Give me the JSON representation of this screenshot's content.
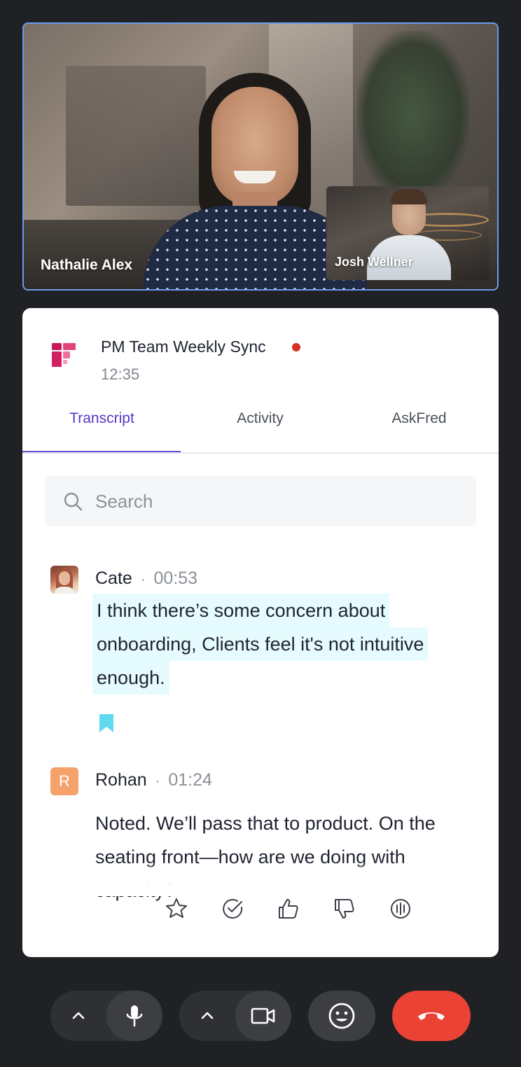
{
  "video": {
    "main_name": "Nathalie Alex",
    "pip_name": "Josh Wellner"
  },
  "meeting": {
    "title": "PM Team Weekly Sync",
    "time": "12:35",
    "live_color": "#d93025"
  },
  "tabs": [
    {
      "label": "Transcript",
      "active": true
    },
    {
      "label": "Activity",
      "active": false
    },
    {
      "label": "AskFred",
      "active": false
    }
  ],
  "search": {
    "placeholder": "Search",
    "value": ""
  },
  "transcript": [
    {
      "speaker": "Cate",
      "sep": "·",
      "timestamp": "00:53",
      "lines": [
        "I think there’s some concern about",
        "onboarding, Clients feel it's not intuitive",
        "enough."
      ],
      "highlighted": true,
      "bookmarked": true
    },
    {
      "speaker": "Rohan",
      "avatar_letter": "R",
      "sep": "·",
      "timestamp": "01:24",
      "lines": [
        "Noted. We’ll pass that to product. On the",
        "seating front—how are we doing with",
        "capacity?"
      ]
    }
  ],
  "actions": [
    "star-icon",
    "check-circle-icon",
    "thumbs-up-icon",
    "thumbs-down-icon",
    "audio-wave-icon"
  ],
  "controls": [
    "chevron-up-icon",
    "microphone-icon",
    "chevron-up-icon",
    "video-camera-icon",
    "emoji-icon",
    "end-call-icon"
  ],
  "colors": {
    "accent": "#5a35c9",
    "highlight": "#e6fbfd",
    "bookmark": "#5fd9ef",
    "end_call": "#ea4335",
    "avatar_r": "#f4a16a"
  }
}
